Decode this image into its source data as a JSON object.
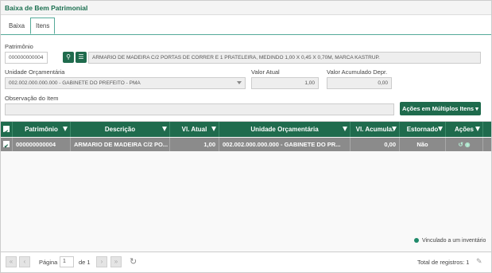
{
  "window_title": "Baixa de Bem Patrimonial",
  "tabs": [
    {
      "label": "Baixa"
    },
    {
      "label": "Itens"
    }
  ],
  "form": {
    "patrimonio_label": "Patrimônio",
    "patrimonio_value": "000000000004",
    "patrimonio_desc": "ARMARIO DE MADEIRA C/2 PORTAS DE CORRER E 1 PRATELEIRA, MEDINDO 1,00 X 0,45 X 0,70M, MARCA KASTRUP.",
    "unidade_label": "Unidade Orçamentária",
    "unidade_value": "002.002.000.000.000 - GABINETE DO PREFEITO - PMA",
    "valor_atual_label": "Valor Atual",
    "valor_atual_value": "1,00",
    "valor_acum_label": "Valor Acumulado Depr.",
    "valor_acum_value": "0,00",
    "obs_label": "Observação do Item",
    "obs_value": "",
    "multi_actions_label": "Ações em Múltiplos Itens"
  },
  "grid": {
    "columns": [
      "Patrimônio",
      "Descrição",
      "Vl. Atual",
      "Unidade Orçamentária",
      "Vl. Acumula.",
      "Estornado",
      "Ações"
    ],
    "rows": [
      [
        "000000000004",
        "ARMARIO DE MADEIRA C/2 PO...",
        "1,00",
        "002.002.000.000.000 - GABINETE DO PR...",
        "0,00",
        "Não"
      ]
    ]
  },
  "legend": "Vinculado a um inventário",
  "pager": {
    "page_label": "Página",
    "page_value": "1",
    "of_label": "de 1",
    "total_label": "Total de registros: 1"
  },
  "colors": {
    "accent": "#1f6b4d",
    "row_selected": "#8b8b8b"
  }
}
